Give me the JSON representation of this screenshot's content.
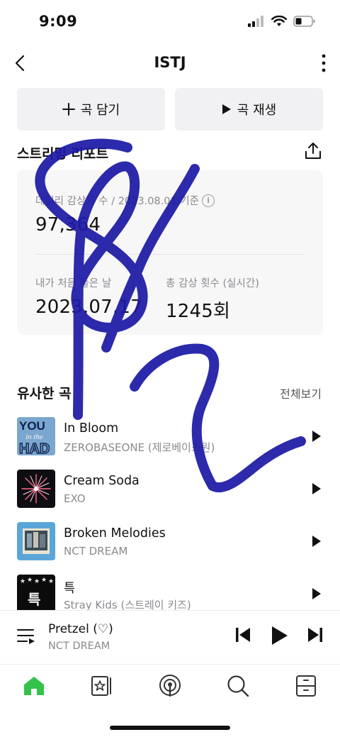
{
  "status_bar": {
    "time": "9:09"
  },
  "nav": {
    "title": "ISTJ"
  },
  "actions": {
    "add_label": "곡 담기",
    "play_label": "곡 재생"
  },
  "report": {
    "title": "스트리밍 리포트",
    "daily_listeners_label": "데일리 감상자 수 / 2023.08.01 기준",
    "daily_listeners_value": "97,364",
    "first_listened_label": "내가 처음 들은 날",
    "first_listened_value": "2023.07.17",
    "total_plays_label": "총 감상 횟수 (실시간)",
    "total_plays_value": "1245회"
  },
  "similar": {
    "title": "유사한 곡",
    "view_all": "전체보기",
    "songs": [
      {
        "title": "In Bloom",
        "artist": "ZEROBASEONE (제로베이스원)"
      },
      {
        "title": "Cream Soda",
        "artist": "EXO"
      },
      {
        "title": "Broken Melodies",
        "artist": "NCT DREAM"
      },
      {
        "title": "특",
        "artist": "Stray Kids (스트레이 키즈)"
      }
    ],
    "thumb_texts": {
      "in_bloom_line1": "YOU",
      "in_bloom_line2": "in the",
      "in_bloom_line3": "HAD",
      "s_class": "특"
    }
  },
  "now_playing": {
    "title": "Pretzel (♡)",
    "artist": "NCT DREAM"
  },
  "tabs": [
    "home-icon",
    "library-icon",
    "podcast-icon",
    "search-icon",
    "storage-icon"
  ],
  "colors": {
    "accent_green": "#34c24a",
    "scribble": "#1d1aa6",
    "battery": "#111111"
  }
}
